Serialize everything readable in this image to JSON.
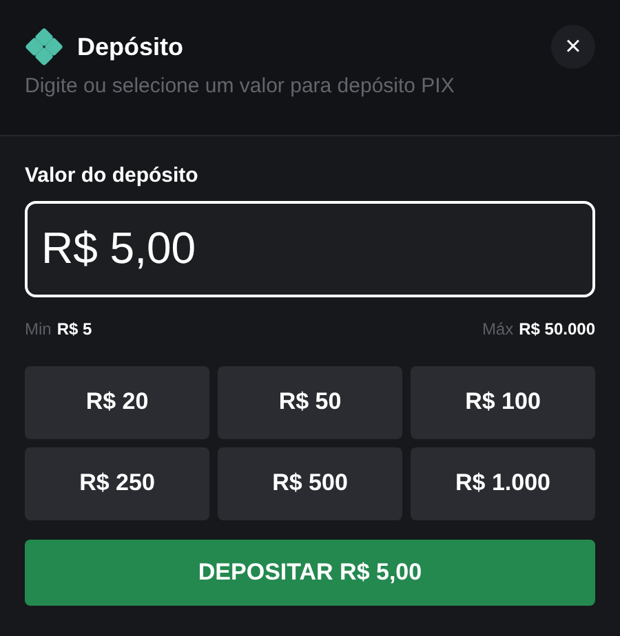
{
  "header": {
    "title": "Depósito",
    "subtitle": "Digite ou selecione um valor para depósito PIX",
    "close": "×"
  },
  "amount_field": {
    "label": "Valor do depósito",
    "value": "R$ 5,00"
  },
  "limits": [
    {
      "label": "Min",
      "value": "R$ 5"
    },
    {
      "label": "Máx",
      "value": "R$ 50.000"
    }
  ],
  "presets": [
    "R$ 20",
    "R$ 50",
    "R$ 100",
    "R$ 250",
    "R$ 500",
    "R$ 1.000"
  ],
  "submit_button": "DEPOSITAR R$ 5,00"
}
